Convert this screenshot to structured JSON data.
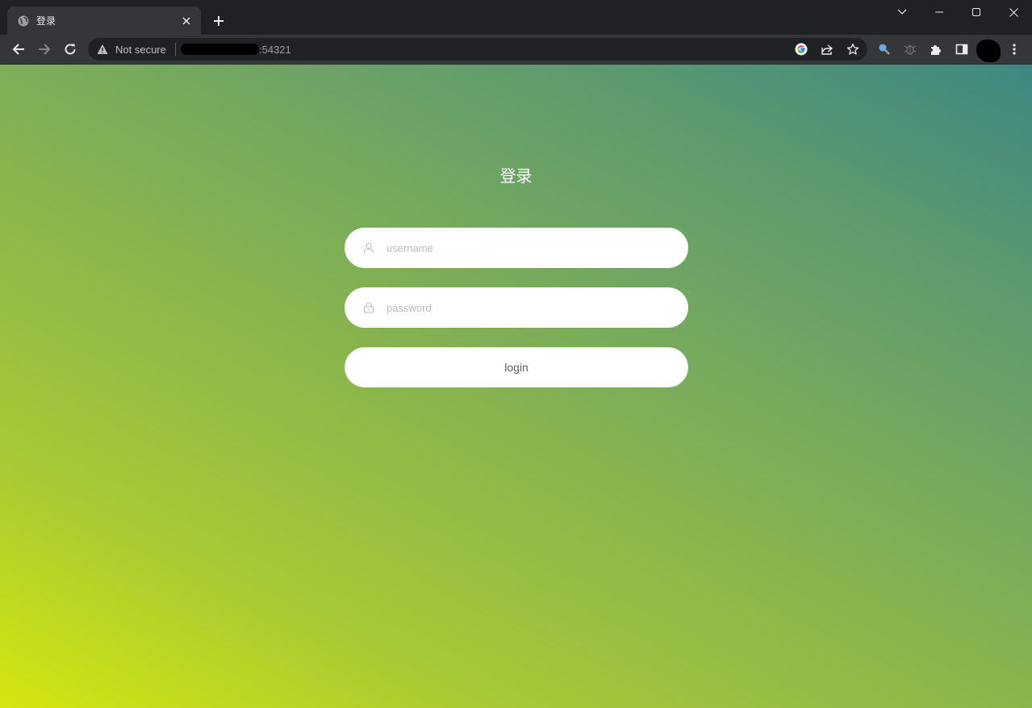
{
  "browser": {
    "tab": {
      "title": "登录"
    },
    "address_bar": {
      "security_label": "Not secure",
      "url_port": ":54321"
    }
  },
  "page": {
    "title": "登录",
    "username": {
      "placeholder": "username",
      "value": ""
    },
    "password": {
      "placeholder": "password",
      "value": ""
    },
    "login_label": "login"
  },
  "icons": {
    "favicon": "globe-icon",
    "username": "user-icon",
    "password": "lock-icon"
  },
  "colors": {
    "gradient_start": "#d4e60f",
    "gradient_end": "#3d8882",
    "chrome_dark": "#202124",
    "chrome_toolbar": "#35363a"
  }
}
